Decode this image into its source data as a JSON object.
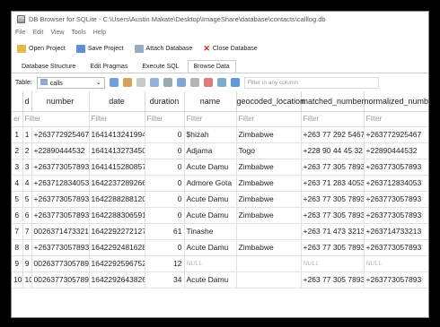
{
  "window": {
    "title": "DB Browser for SQLite - C:\\Users\\Austin Makate\\Desktop\\ImageShare\\database\\contacts\\calllog.db"
  },
  "menu": [
    "File",
    "Edit",
    "View",
    "Tools",
    "Help"
  ],
  "toolbar": {
    "open_project": "Open Project",
    "save_project": "Save Project",
    "attach_database": "Attach Database",
    "close_database": "Close Database"
  },
  "tabs": [
    "Database Structure",
    "Edit Pragmas",
    "Execute SQL",
    "Browse Data"
  ],
  "browse": {
    "table_label": "Table:",
    "table_value": "calls",
    "filter_placeholder": "Filter in any column"
  },
  "grid": {
    "columns": [
      "d",
      "number",
      "date",
      "duration",
      "name",
      "geocoded_location",
      "matched_number",
      "normalized_number"
    ],
    "filter_row": [
      "er",
      "Filter",
      "Filter",
      "Filter",
      "Filter",
      "Filter",
      "Filter",
      "Filter",
      "Filter"
    ],
    "rows": [
      [
        "1",
        "1",
        "+263772925467",
        "1641413241994",
        "0",
        "$hizah",
        "Zimbabwe",
        "+263 77 292 5467",
        "+263772925467"
      ],
      [
        "2",
        "2",
        "+22890444532",
        "1641413273450",
        "0",
        "Adjama",
        "Togo",
        "+228 90 44 45 32",
        "+22890444532"
      ],
      [
        "3",
        "3",
        "+263773057893",
        "1641415280857",
        "0",
        "Acute Damu",
        "Zimbabwe",
        "+263 77 305 7893",
        "+263773057893"
      ],
      [
        "4",
        "4",
        "+263712834053",
        "1642237289266",
        "0",
        "Admore Gota",
        "Zimbabwe",
        "+263 71 283 4053",
        "+263712834053"
      ],
      [
        "5",
        "5",
        "+263773057893",
        "1642288288120",
        "0",
        "Acute Damu",
        "Zimbabwe",
        "+263 77 305 7893",
        "+263773057893"
      ],
      [
        "6",
        "6",
        "+263773057893",
        "1642288306591",
        "0",
        "Acute Damu",
        "Zimbabwe",
        "+263 77 305 7893",
        "+263773057893"
      ],
      [
        "7",
        "7",
        "00263714733213",
        "1642292272127",
        "61",
        "Tinashe",
        "",
        "+263 71 473 3213",
        "+263714733213"
      ],
      [
        "8",
        "8",
        "+263773057893",
        "1642292481628",
        "0",
        "Acute Damu",
        "Zimbabwe",
        "+263 77 305 7893",
        "+263773057893"
      ],
      [
        "9",
        "9",
        "0026377305789",
        "1642292596752",
        "12",
        "NULL",
        "",
        "NULL",
        "NULL"
      ],
      [
        "10",
        "10",
        "00263773057893",
        "1642292643826",
        "34",
        "Acute Damu",
        "",
        "+263 77 305 7893",
        "+263773057893"
      ]
    ]
  },
  "colors": {
    "null_text": "#bbbbbb",
    "close_icon": "#dd2222"
  }
}
